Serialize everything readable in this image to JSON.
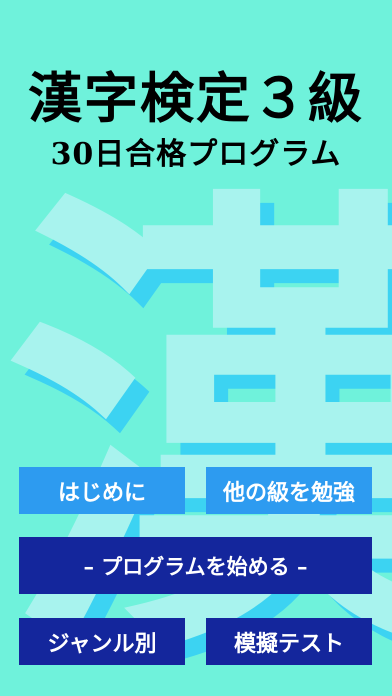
{
  "background": {
    "kanji": "漢",
    "color": "#6ff2db",
    "kanji_color": "#3cd3f2",
    "kanji_highlight_color": "#a8f3ee"
  },
  "header": {
    "title": "漢字検定３級",
    "subtitle": "30日合格プログラム"
  },
  "buttons": {
    "intro": "はじめに",
    "other_grade": "他の級を勉強",
    "start_program": "– プログラムを始める –",
    "by_genre": "ジャンル別",
    "mock_test": "模擬テスト"
  },
  "colors": {
    "light_button": "#2d9bf0",
    "dark_button": "#14269c",
    "button_text": "#ffffff",
    "title_text": "#000000"
  }
}
